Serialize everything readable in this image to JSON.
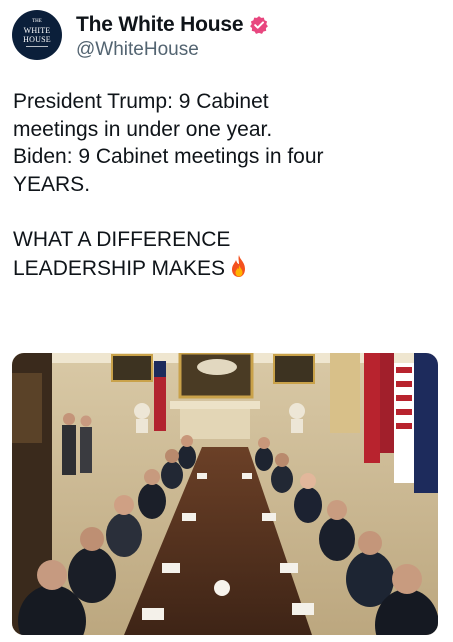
{
  "account": {
    "avatar": {
      "line1": "THE",
      "line2": "WHITE",
      "line3": "HOUSE"
    },
    "display_name": "The White House",
    "handle": "@WhiteHouse",
    "verified": true,
    "badge_color": "#e8477f"
  },
  "tweet": {
    "paragraph1": "President Trump: 9 Cabinet\nmeetings in under one year.\nBiden: 9 Cabinet meetings in four\nYEARS.",
    "paragraph2": "WHAT A DIFFERENCE\nLEADERSHIP MAKES",
    "emoji": "fire-icon"
  },
  "media": {
    "type": "photo",
    "subject": "cabinet-meeting-photo"
  }
}
